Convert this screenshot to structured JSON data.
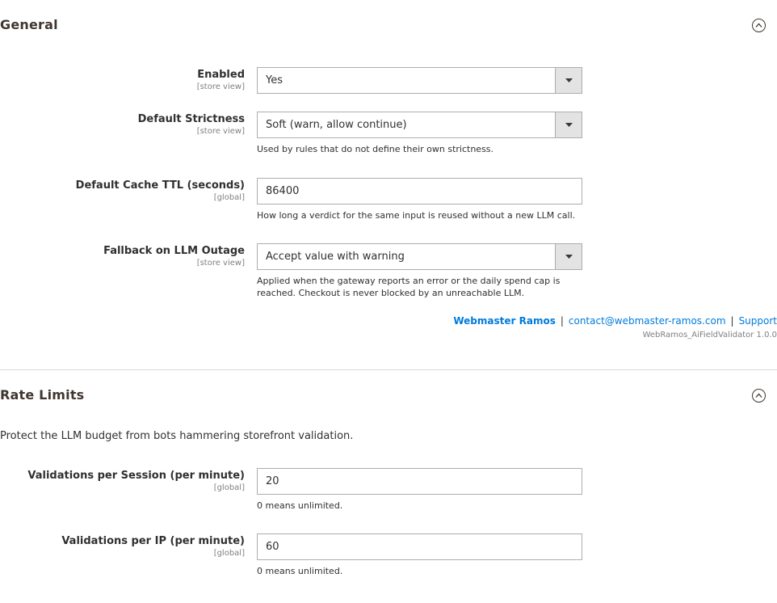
{
  "general": {
    "title": "General",
    "fields": {
      "enabled": {
        "label": "Enabled",
        "scope": "[store view]",
        "value": "Yes"
      },
      "strictness": {
        "label": "Default Strictness",
        "scope": "[store view]",
        "value": "Soft (warn, allow continue)",
        "note": "Used by rules that do not define their own strictness."
      },
      "cache_ttl": {
        "label": "Default Cache TTL (seconds)",
        "scope": "[global]",
        "value": "86400",
        "note": "How long a verdict for the same input is reused without a new LLM call."
      },
      "fallback": {
        "label": "Fallback on LLM Outage",
        "scope": "[store view]",
        "value": "Accept value with warning",
        "note": "Applied when the gateway reports an error or the daily spend cap is reached. Checkout is never blocked by an unreachable LLM."
      }
    },
    "footer": {
      "brand": "Webmaster Ramos",
      "separator": "|",
      "email": "contact@webmaster-ramos.com",
      "support": "Support",
      "module": "WebRamos_AiFieldValidator 1.0.0"
    }
  },
  "rate_limits": {
    "title": "Rate Limits",
    "intro": "Protect the LLM budget from bots hammering storefront validation.",
    "fields": {
      "per_session": {
        "label": "Validations per Session (per minute)",
        "scope": "[global]",
        "value": "20",
        "note": "0 means unlimited."
      },
      "per_ip": {
        "label": "Validations per IP (per minute)",
        "scope": "[global]",
        "value": "60",
        "note": "0 means unlimited."
      }
    }
  },
  "icons": {
    "collapse": "chevron-up-circle-icon",
    "dropdown": "caret-down-icon"
  },
  "colors": {
    "link": "#007bdb",
    "heading": "#41362f",
    "text": "#303030",
    "muted": "#808080",
    "border": "#adadad",
    "select_arrow_bg": "#e3e3e3"
  }
}
